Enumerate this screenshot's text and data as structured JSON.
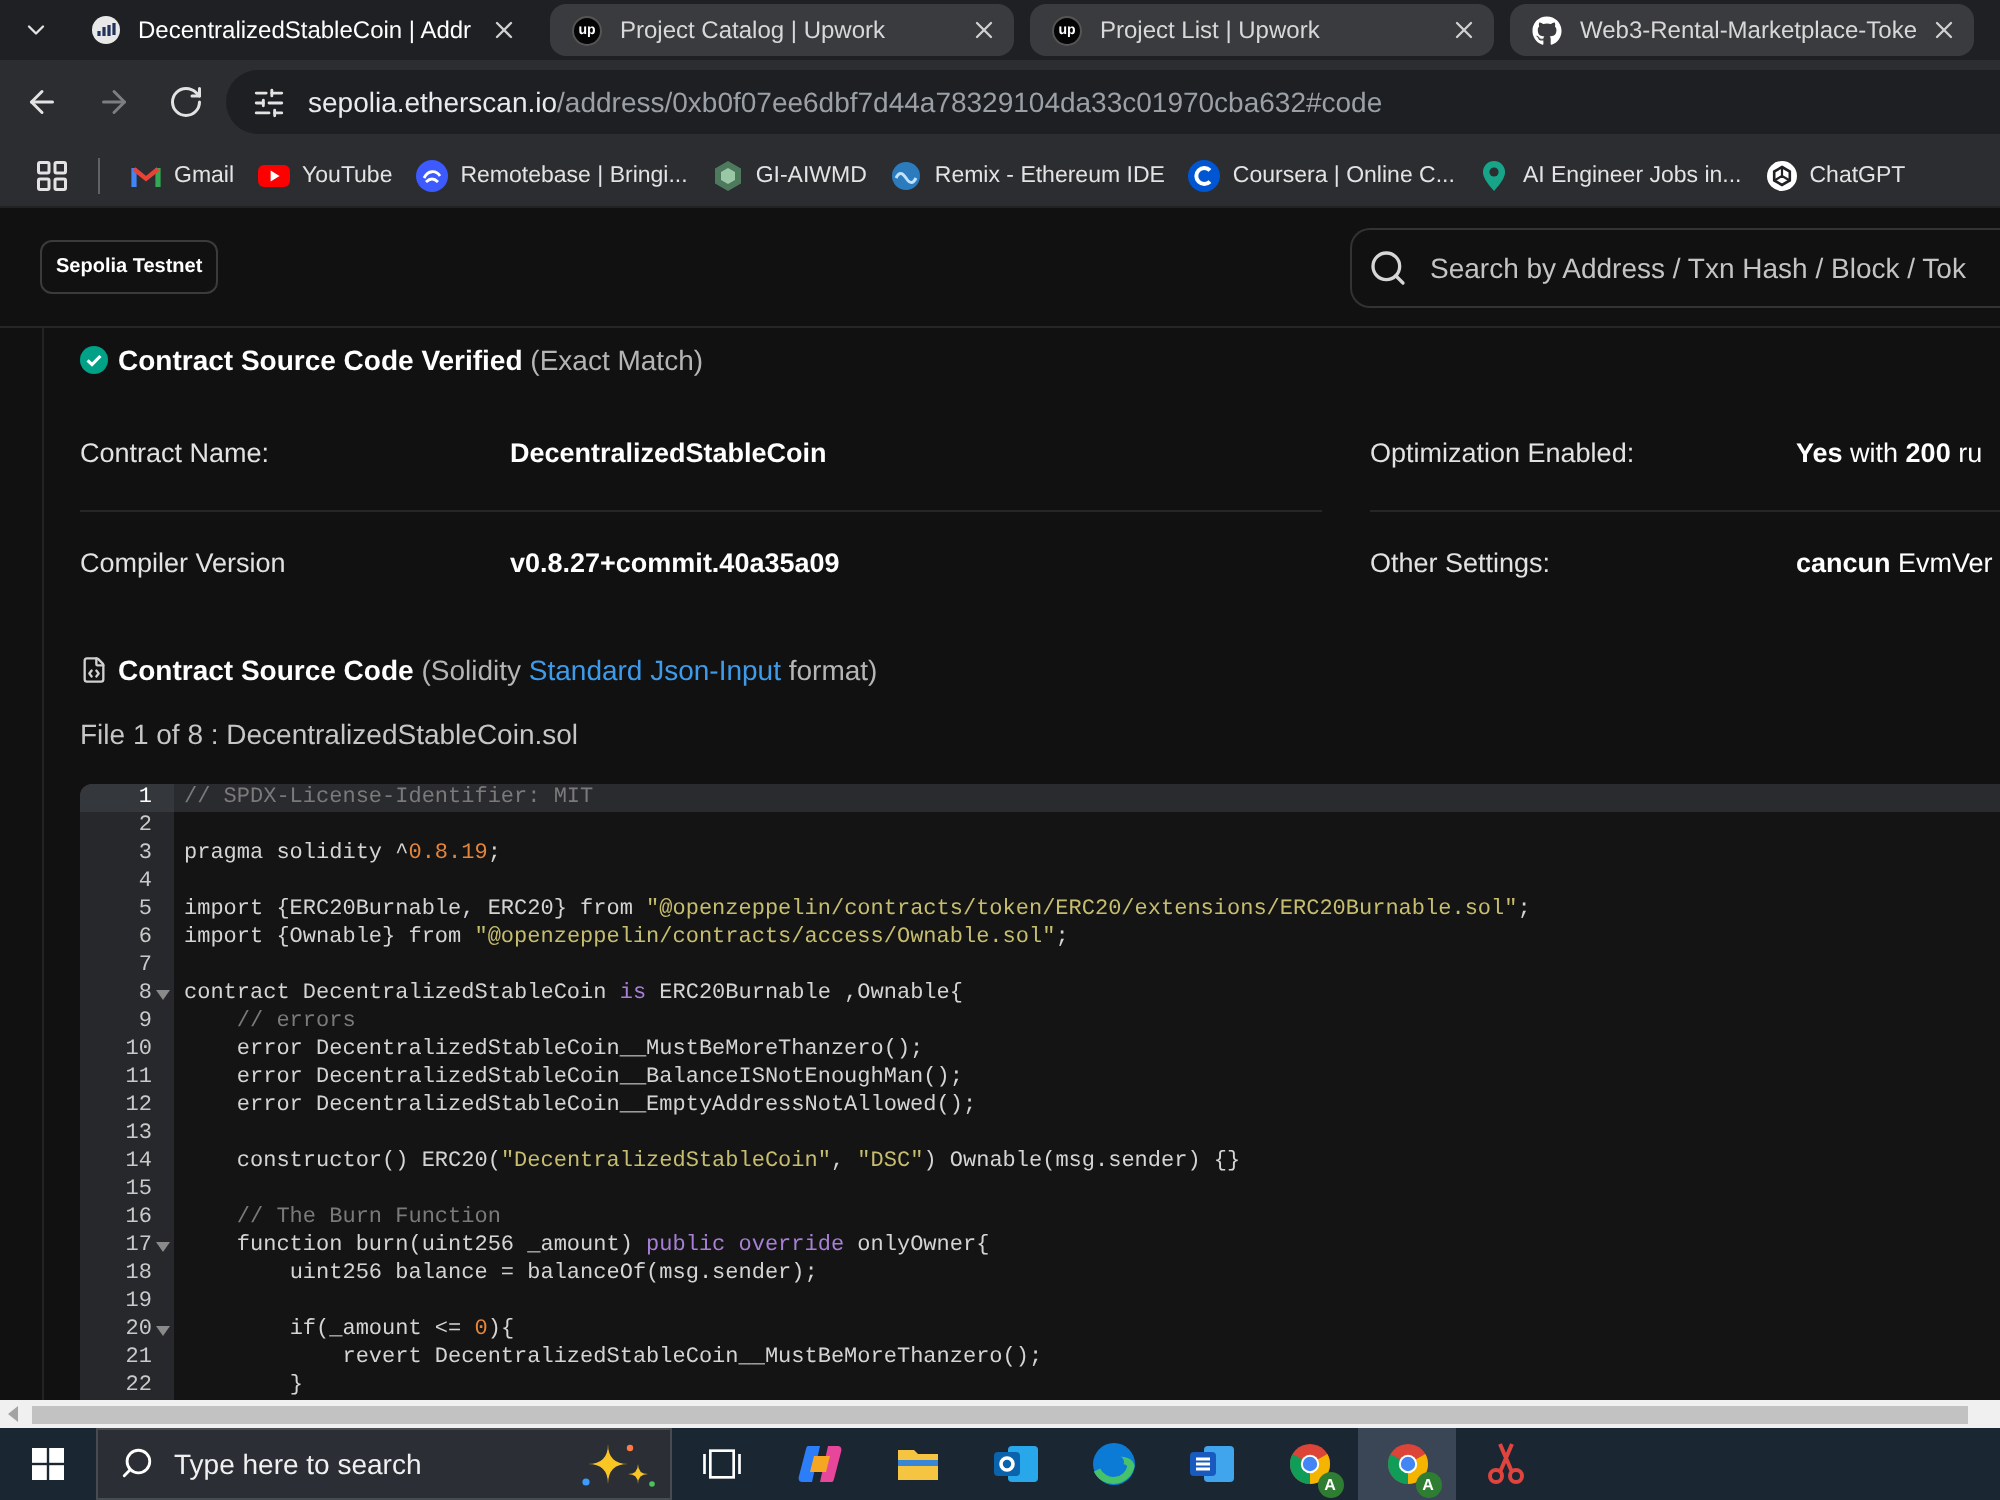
{
  "browser": {
    "tabs": [
      {
        "kind": "etherscan",
        "title": "DecentralizedStableCoin | Addr",
        "selected": true
      },
      {
        "kind": "upwork",
        "icon_text": "up",
        "title": "Project Catalog | Upwork",
        "selected": false
      },
      {
        "kind": "upwork",
        "icon_text": "up",
        "title": "Project List | Upwork",
        "selected": false
      },
      {
        "kind": "github",
        "title": "Web3-Rental-Marketplace-Toke",
        "selected": false
      }
    ],
    "nav_buttons": [
      {
        "kind": "back",
        "disabled": false
      },
      {
        "kind": "forward",
        "disabled": true
      },
      {
        "kind": "reload",
        "disabled": false
      }
    ],
    "address": {
      "host": "sepolia.etherscan.io",
      "path": "/address/0xb0f07ee6dbf7d44a78329104da33c01970cba632#code"
    },
    "bookmarks": [
      {
        "kind": "gmail",
        "label": "Gmail"
      },
      {
        "kind": "youtube",
        "label": "YouTube"
      },
      {
        "kind": "remotebase",
        "label": "Remotebase | Bringi..."
      },
      {
        "kind": "hexagon",
        "label": "GI-AIWMD"
      },
      {
        "kind": "remix",
        "label": "Remix - Ethereum IDE"
      },
      {
        "kind": "coursera",
        "label": "Coursera | Online C..."
      },
      {
        "kind": "pin",
        "label": "AI Engineer Jobs in..."
      },
      {
        "kind": "knot",
        "label": "ChatGPT"
      }
    ]
  },
  "page": {
    "network_badge": "Sepolia Testnet",
    "search": {
      "placeholder": "Search by Address / Txn Hash / Block / Tok"
    },
    "verified": {
      "title": "Contract Source Code Verified",
      "note": "(Exact Match)"
    },
    "contract_info": [
      {
        "rows": [
          {
            "label": "Contract Name:",
            "value": "DecentralizedStableCoin",
            "kind": "bold"
          },
          {
            "label": "Compiler Version",
            "value": "v0.8.27+commit.40a35a09",
            "kind": "bold"
          }
        ]
      },
      {
        "rows": [
          {
            "label": "Optimization Enabled:",
            "value": "**Yes** with **200** ru",
            "kind": "mixed"
          },
          {
            "label": "Other Settings:",
            "value": "**cancun** EvmVer",
            "kind": "mixed"
          }
        ]
      }
    ],
    "source_heading": {
      "title": "Contract Source Code",
      "prefix": "(Solidity",
      "link": "Standard Json-Input",
      "suffix": "format)"
    },
    "file_label": "File 1 of 8 : DecentralizedStableCoin.sol",
    "code": {
      "lines": [
        {
          "number": "1",
          "selected": true,
          "foldable": false,
          "tokens": [
            {
              "kind": "comment",
              "text": "// SPDX-License-Identifier: MIT"
            }
          ]
        },
        {
          "number": "2",
          "selected": false,
          "foldable": false
        },
        {
          "number": "3",
          "selected": false,
          "foldable": false,
          "tokens": [
            {
              "kind": "plain",
              "text": "pragma solidity ^"
            },
            {
              "kind": "number",
              "text": "0.8.19"
            },
            {
              "kind": "plain",
              "text": ";"
            }
          ]
        },
        {
          "number": "4",
          "selected": false,
          "foldable": false
        },
        {
          "number": "5",
          "selected": false,
          "foldable": false,
          "tokens": [
            {
              "kind": "plain",
              "text": "import {ERC20Burnable, ERC20} from "
            },
            {
              "kind": "string",
              "text": "\"@openzeppelin/contracts/token/ERC20/extensions/ERC20Burnable.sol\""
            },
            {
              "kind": "plain",
              "text": ";"
            }
          ]
        },
        {
          "number": "6",
          "selected": false,
          "foldable": false,
          "tokens": [
            {
              "kind": "plain",
              "text": "import {Ownable} from "
            },
            {
              "kind": "string",
              "text": "\"@openzeppelin/contracts/access/Ownable.sol\""
            },
            {
              "kind": "plain",
              "text": ";"
            }
          ]
        },
        {
          "number": "7",
          "selected": false,
          "foldable": false
        },
        {
          "number": "8",
          "selected": false,
          "foldable": true,
          "tokens": [
            {
              "kind": "plain",
              "text": "contract DecentralizedStableCoin "
            },
            {
              "kind": "keyword",
              "text": "is"
            },
            {
              "kind": "plain",
              "text": " ERC20Burnable ,Ownable{"
            }
          ]
        },
        {
          "number": "9",
          "selected": false,
          "foldable": false,
          "tokens": [
            {
              "kind": "comment",
              "text": "    // errors"
            }
          ]
        },
        {
          "number": "10",
          "selected": false,
          "foldable": false,
          "tokens": [
            {
              "kind": "plain",
              "text": "    error DecentralizedStableCoin__MustBeMoreThanzero();"
            }
          ]
        },
        {
          "number": "11",
          "selected": false,
          "foldable": false,
          "tokens": [
            {
              "kind": "plain",
              "text": "    error DecentralizedStableCoin__BalanceISNotEnoughMan();"
            }
          ]
        },
        {
          "number": "12",
          "selected": false,
          "foldable": false,
          "tokens": [
            {
              "kind": "plain",
              "text": "    error DecentralizedStableCoin__EmptyAddressNotAllowed();"
            }
          ]
        },
        {
          "number": "13",
          "selected": false,
          "foldable": false
        },
        {
          "number": "14",
          "selected": false,
          "foldable": false,
          "tokens": [
            {
              "kind": "plain",
              "text": "    constructor() ERC20("
            },
            {
              "kind": "string",
              "text": "\"DecentralizedStableCoin\""
            },
            {
              "kind": "plain",
              "text": ", "
            },
            {
              "kind": "string",
              "text": "\"DSC\""
            },
            {
              "kind": "plain",
              "text": ") Ownable(msg.sender) {}"
            }
          ]
        },
        {
          "number": "15",
          "selected": false,
          "foldable": false
        },
        {
          "number": "16",
          "selected": false,
          "foldable": false,
          "tokens": [
            {
              "kind": "comment",
              "text": "    // The Burn Function"
            }
          ]
        },
        {
          "number": "17",
          "selected": false,
          "foldable": true,
          "tokens": [
            {
              "kind": "plain",
              "text": "    function burn(uint256 _amount) "
            },
            {
              "kind": "keyword",
              "text": "public override"
            },
            {
              "kind": "plain",
              "text": " onlyOwner{"
            }
          ]
        },
        {
          "number": "18",
          "selected": false,
          "foldable": false,
          "tokens": [
            {
              "kind": "plain",
              "text": "        uint256 balance = balanceOf(msg.sender);"
            }
          ]
        },
        {
          "number": "19",
          "selected": false,
          "foldable": false
        },
        {
          "number": "20",
          "selected": false,
          "foldable": true,
          "tokens": [
            {
              "kind": "plain",
              "text": "        if(_amount <= "
            },
            {
              "kind": "number",
              "text": "0"
            },
            {
              "kind": "plain",
              "text": "){"
            }
          ]
        },
        {
          "number": "21",
          "selected": false,
          "foldable": false,
          "tokens": [
            {
              "kind": "plain",
              "text": "            revert DecentralizedStableCoin__MustBeMoreThanzero();"
            }
          ]
        },
        {
          "number": "22",
          "selected": false,
          "foldable": false,
          "tokens": [
            {
              "kind": "plain",
              "text": "        }"
            }
          ]
        }
      ]
    }
  },
  "taskbar": {
    "search": {
      "placeholder": "Type here to search"
    },
    "apps": [
      {
        "kind": "task-view",
        "selected": false
      },
      {
        "kind": "copilot",
        "selected": false
      },
      {
        "kind": "folder",
        "selected": false
      },
      {
        "kind": "outlook",
        "selected": false
      },
      {
        "kind": "edge",
        "selected": false
      },
      {
        "kind": "word",
        "selected": false
      },
      {
        "kind": "chrome",
        "badge": "A",
        "selected": false
      },
      {
        "kind": "chrome",
        "badge": "A",
        "selected": true
      },
      {
        "kind": "snipping",
        "selected": false
      }
    ]
  }
}
